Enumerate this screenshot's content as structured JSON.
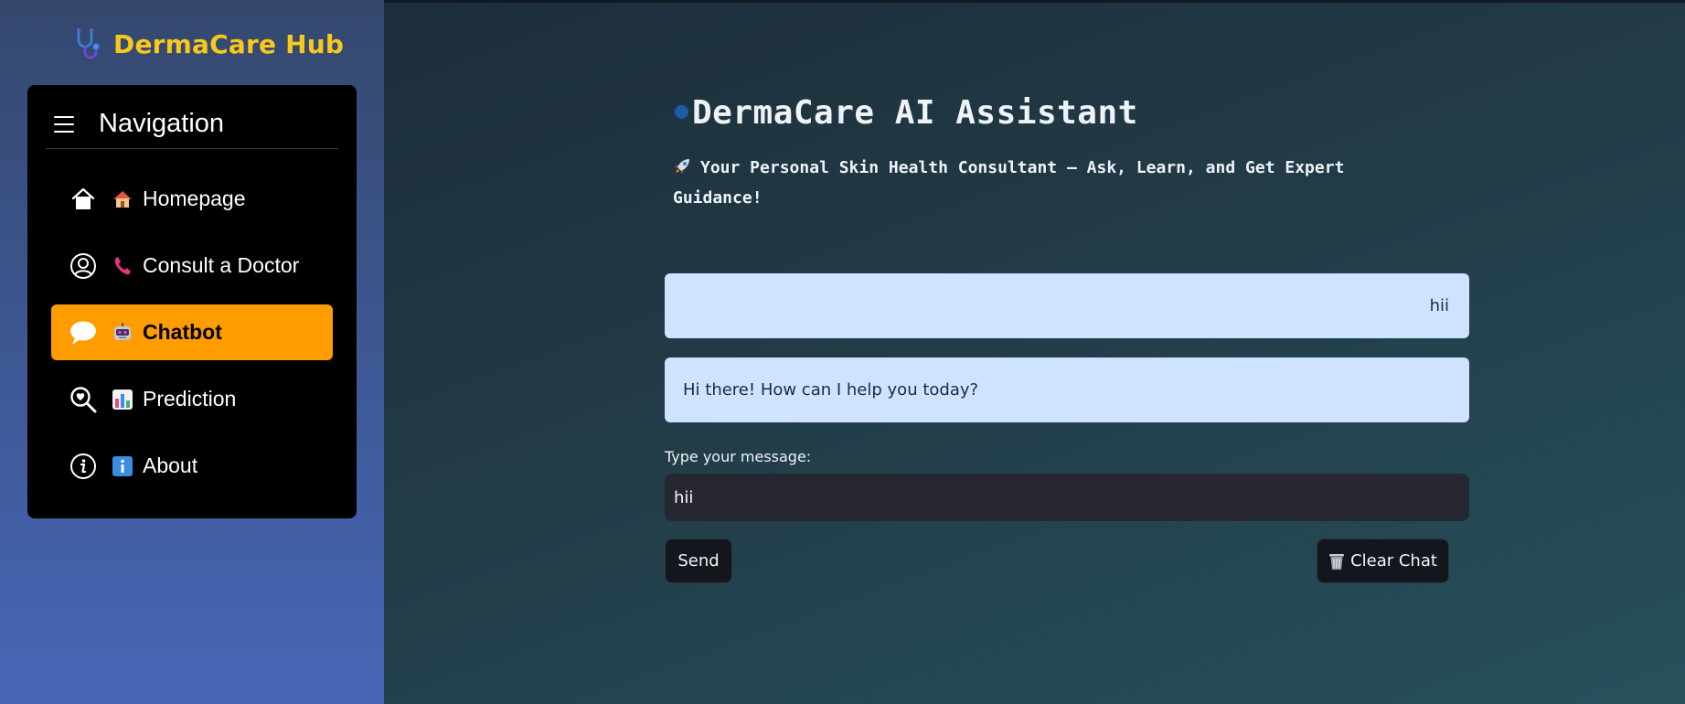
{
  "sidebar": {
    "brand": {
      "icon": "stethoscope-icon",
      "title": "DermaCare Hub",
      "color": "#f8c81b"
    },
    "nav": {
      "title": "Navigation",
      "menu_icon": "hamburger-icon",
      "items": [
        {
          "icon": "house-icon",
          "emoji": "house-emoji",
          "label": "Homepage",
          "active": false
        },
        {
          "icon": "person-circle-icon",
          "emoji": "telephone-emoji",
          "label": "Consult a Doctor",
          "active": false
        },
        {
          "icon": "chat-bubble-icon",
          "emoji": "robot-emoji",
          "label": "Chatbot",
          "active": true
        },
        {
          "icon": "search-heart-icon",
          "emoji": "bar-chart-emoji",
          "label": "Prediction",
          "active": false
        },
        {
          "icon": "info-circle-icon",
          "emoji": "info-emoji",
          "label": "About",
          "active": false
        }
      ],
      "active_color": "#ff9c00"
    }
  },
  "main": {
    "title": "DermaCare AI Assistant",
    "title_dot_color": "#1f5aa7",
    "subtitle": "Your Personal Skin Health Consultant – Ask, Learn, and Get Expert Guidance!",
    "subtitle_icon": "rocket-emoji",
    "messages": [
      {
        "role": "user",
        "text": "hii"
      },
      {
        "role": "assistant",
        "text": "Hi there! How can I help you today?"
      }
    ],
    "message_bg": "#cfe2ff",
    "input": {
      "label": "Type your message:",
      "value": "hii",
      "placeholder": ""
    },
    "buttons": {
      "send": "Send",
      "clear": "Clear Chat",
      "clear_icon": "wastebasket-icon"
    }
  }
}
